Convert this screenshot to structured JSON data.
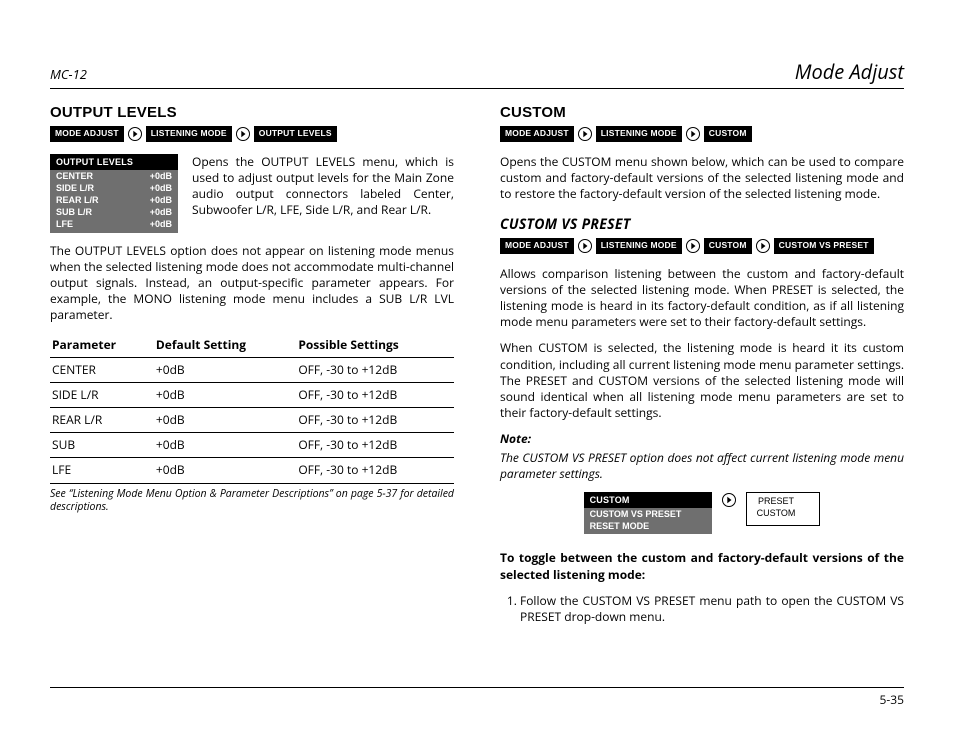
{
  "header": {
    "product": "MC-12",
    "section": "Mode Adjust"
  },
  "nav_chips": {
    "mode_adjust": "MODE ADJUST",
    "listening_mode": "Listening Mode",
    "output_levels": "OUTPUT LEVELS",
    "custom": "CUSTOM",
    "custom_vs_preset": "CUSTOM VS PRESET"
  },
  "left": {
    "title": "Output Levels",
    "osd": {
      "title": "OUTPUT LEVELS",
      "rows": [
        {
          "label": "CENTER",
          "value": "+0dB"
        },
        {
          "label": "SIDE L/R",
          "value": "+0dB"
        },
        {
          "label": "REAR L/R",
          "value": "+0dB"
        },
        {
          "label": "SUB L/R",
          "value": "+0dB"
        },
        {
          "label": "LFE",
          "value": "+0dB"
        }
      ]
    },
    "intro": "Opens the OUTPUT LEVELS menu, which is used to adjust output levels for the Main Zone audio output connectors labeled Center, Subwoofer L/R, LFE, Side L/R, and Rear L/R.",
    "para2": "The OUTPUT LEVELS option does not appear on listening mode menus when the selected listening mode does not accommodate multi-channel output signals. Instead, an output-specific parameter appears. For example, the MONO listening mode menu includes a SUB L/R LVL parameter.",
    "table": {
      "headers": [
        "Parameter",
        "Default Setting",
        "Possible Settings"
      ],
      "rows": [
        [
          "CENTER",
          "+0dB",
          "OFF, -30 to +12dB"
        ],
        [
          "SIDE L/R",
          "+0dB",
          "OFF, -30 to +12dB"
        ],
        [
          "REAR L/R",
          "+0dB",
          "OFF, -30 to +12dB"
        ],
        [
          "SUB",
          "+0dB",
          "OFF, -30 to +12dB"
        ],
        [
          "LFE",
          "+0dB",
          "OFF, -30 to +12dB"
        ]
      ]
    },
    "caption": "See “Listening Mode Menu Option & Parameter Descriptions” on page 5-37 for detailed descriptions."
  },
  "right": {
    "custom": {
      "title": "Custom",
      "para": "Opens the CUSTOM menu shown below, which can be used to compare custom and factory-default versions of the selected listening mode and to restore the factory-default version of the selected listening mode."
    },
    "cvp": {
      "title": "CUSTOM VS PRESET",
      "p1": "Allows comparison listening between the custom and factory-default versions of the selected listening mode. When PRESET is selected, the listening mode is heard in its factory-default condition, as if all listening mode menu parameters were set to their factory-default settings.",
      "p2": "When CUSTOM is selected, the listening mode is heard it its custom condition, including all current listening mode menu parameter settings. The PRESET and CUSTOM versions of the selected listening mode will sound identical when all listening mode menu parameters are set to their factory-default settings.",
      "note_label": "Note:",
      "note_body": "The CUSTOM VS PRESET option does not affect current listening mode menu parameter settings.",
      "osd": {
        "title": "CUSTOM",
        "rows": [
          {
            "label": "CUSTOM VS PRESET"
          },
          {
            "label": "RESET MODE"
          }
        ]
      },
      "dropdown": {
        "line1": "PRESET",
        "line2": "CUSTOM"
      },
      "lead": "To toggle between the custom and factory-default versions of the selected listening mode:",
      "step1": "Follow the CUSTOM VS PRESET menu path to open the CUS­TOM VS PRESET drop-down menu."
    }
  },
  "footer": {
    "page": "5-35"
  }
}
